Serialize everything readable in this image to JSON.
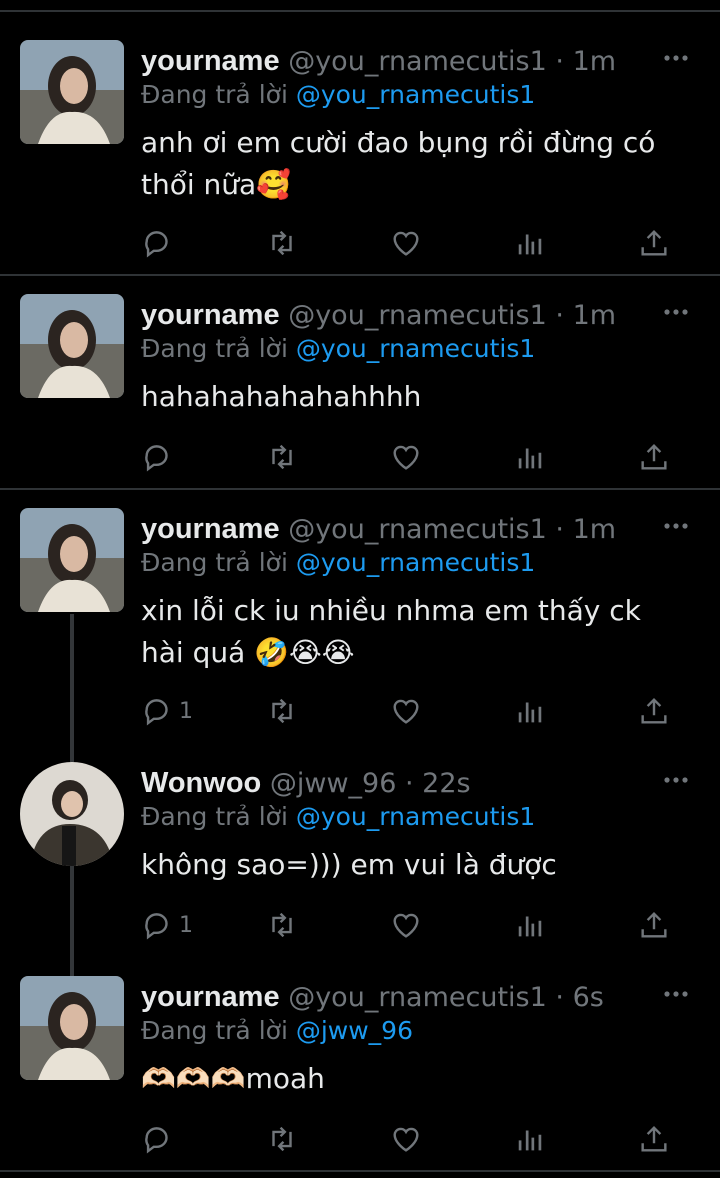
{
  "tweets": [
    {
      "name": "yourname",
      "handle": "@you_rnamecutis1",
      "time": "1m",
      "reply_prefix": "Đang trả lời",
      "reply_to": "@you_rnamecutis1",
      "text": "anh ơi em cười đao bụng rồi đừng có thổi nữa🥰",
      "reply_count": "",
      "avatar": "yourname-avatar"
    },
    {
      "name": "yourname",
      "handle": "@you_rnamecutis1",
      "time": "1m",
      "reply_prefix": "Đang trả lời",
      "reply_to": "@you_rnamecutis1",
      "text": "hahahahahahahhhh",
      "reply_count": "",
      "avatar": "yourname-avatar"
    },
    {
      "name": "yourname",
      "handle": "@you_rnamecutis1",
      "time": "1m",
      "reply_prefix": "Đang trả lời",
      "reply_to": "@you_rnamecutis1",
      "text": "xin lỗi ck iu nhiều nhma em thấy ck hài quá 🤣😭😭",
      "reply_count": "1",
      "avatar": "yourname-avatar"
    },
    {
      "name": "Wonwoo",
      "handle": "@jww_96",
      "time": "22s",
      "reply_prefix": "Đang trả lời",
      "reply_to": "@you_rnamecutis1",
      "text": "không sao=))) em vui là được",
      "reply_count": "1",
      "avatar": "wonwoo-avatar"
    },
    {
      "name": "yourname",
      "handle": "@you_rnamecutis1",
      "time": "6s",
      "reply_prefix": "Đang trả lời",
      "reply_to": "@jww_96",
      "text": "🫶🏻🫶🏻🫶🏻moah",
      "reply_count": "",
      "avatar": "yourname-avatar"
    }
  ],
  "separator": "·",
  "icons": [
    "reply-icon",
    "retweet-icon",
    "like-icon",
    "views-icon",
    "share-icon",
    "more-icon"
  ],
  "colors": {
    "background": "#000000",
    "text": "#e7e9ea",
    "muted": "#71767b",
    "link": "#1d9bf0",
    "divider": "#2f3336"
  }
}
